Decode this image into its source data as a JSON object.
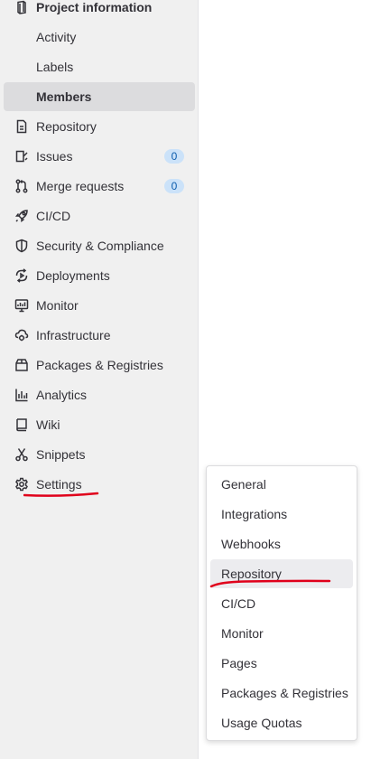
{
  "sidebar": {
    "header_label": "Project information",
    "sub_items": [
      {
        "label": "Activity"
      },
      {
        "label": "Labels"
      },
      {
        "label": "Members"
      }
    ],
    "items": [
      {
        "label": "Repository",
        "icon": "doc-icon"
      },
      {
        "label": "Issues",
        "icon": "issues-icon",
        "badge": "0"
      },
      {
        "label": "Merge requests",
        "icon": "merge-request-icon",
        "badge": "0"
      },
      {
        "label": "CI/CD",
        "icon": "rocket-icon"
      },
      {
        "label": "Security & Compliance",
        "icon": "shield-icon"
      },
      {
        "label": "Deployments",
        "icon": "deployments-icon"
      },
      {
        "label": "Monitor",
        "icon": "monitor-icon"
      },
      {
        "label": "Infrastructure",
        "icon": "cloud-gear-icon"
      },
      {
        "label": "Packages & Registries",
        "icon": "package-icon"
      },
      {
        "label": "Analytics",
        "icon": "chart-icon"
      },
      {
        "label": "Wiki",
        "icon": "book-icon"
      },
      {
        "label": "Snippets",
        "icon": "scissors-icon"
      },
      {
        "label": "Settings",
        "icon": "gear-icon"
      }
    ]
  },
  "settings_flyout": {
    "items": [
      {
        "label": "General"
      },
      {
        "label": "Integrations"
      },
      {
        "label": "Webhooks"
      },
      {
        "label": "Repository"
      },
      {
        "label": "CI/CD"
      },
      {
        "label": "Monitor"
      },
      {
        "label": "Pages"
      },
      {
        "label": "Packages & Registries"
      },
      {
        "label": "Usage Quotas"
      }
    ]
  },
  "colors": {
    "sidebar_bg": "#f0f0f0",
    "active_bg": "#dcdcde",
    "badge_bg": "#cbe2f9",
    "badge_text": "#0b5cad",
    "annotation": "#e0001b"
  }
}
